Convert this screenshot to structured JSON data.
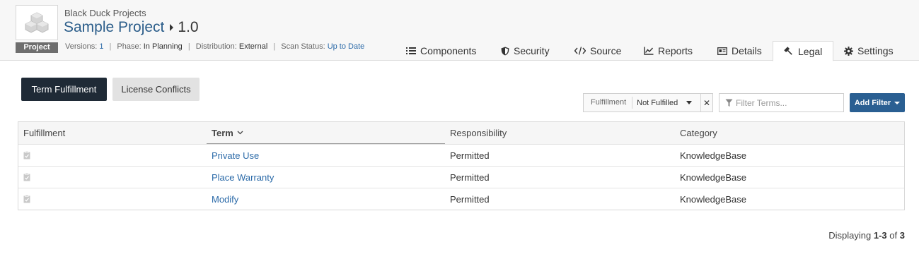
{
  "project": {
    "parent": "Black Duck Projects",
    "name": "Sample Project",
    "version": "1.0",
    "badge": "Project"
  },
  "meta": {
    "versions_label": "Versions:",
    "versions_value": "1",
    "phase_label": "Phase:",
    "phase_value": "In Planning",
    "distribution_label": "Distribution:",
    "distribution_value": "External",
    "scan_label": "Scan Status:",
    "scan_value": "Up to Date",
    "separator": "|"
  },
  "tabs": [
    {
      "label": "Components",
      "icon": "list-icon"
    },
    {
      "label": "Security",
      "icon": "shield-icon"
    },
    {
      "label": "Source",
      "icon": "code-icon"
    },
    {
      "label": "Reports",
      "icon": "line-chart-icon"
    },
    {
      "label": "Details",
      "icon": "id-card-icon"
    },
    {
      "label": "Legal",
      "icon": "gavel-icon",
      "active": true
    },
    {
      "label": "Settings",
      "icon": "gear-icon"
    }
  ],
  "toggle": {
    "term_fulfillment": "Term Fulfillment",
    "license_conflicts": "License Conflicts"
  },
  "filter": {
    "chip_label": "Fulfillment",
    "chip_value": "Not Fulfilled",
    "remove": "✕",
    "search_placeholder": "Filter Terms...",
    "add_filter": "Add Filter"
  },
  "table": {
    "headers": {
      "fulfillment": "Fulfillment",
      "term": "Term",
      "responsibility": "Responsibility",
      "category": "Category"
    },
    "rows": [
      {
        "term": "Private Use",
        "responsibility": "Permitted",
        "category": "KnowledgeBase"
      },
      {
        "term": "Place Warranty",
        "responsibility": "Permitted",
        "category": "KnowledgeBase"
      },
      {
        "term": "Modify",
        "responsibility": "Permitted",
        "category": "KnowledgeBase"
      }
    ]
  },
  "footer": {
    "prefix": "Displaying",
    "range": "1-3",
    "of": "of",
    "total": "3"
  },
  "colors": {
    "accent": "#2b5d8a",
    "link": "#2b6aa8",
    "dark_button": "#1f2a36",
    "primary_button": "#2a5f92"
  }
}
